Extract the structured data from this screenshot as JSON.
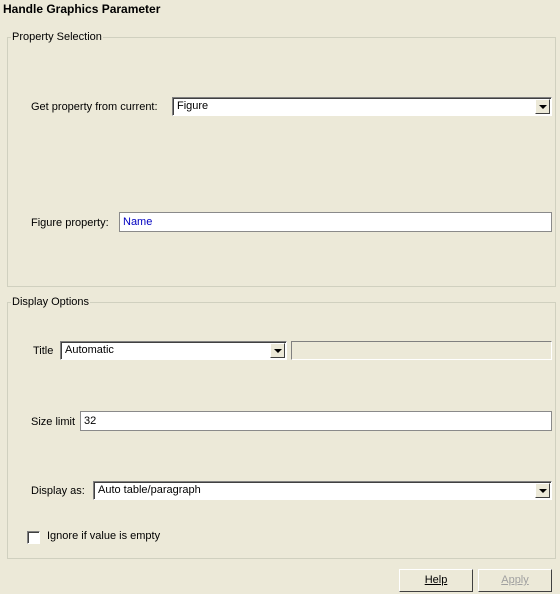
{
  "header": {
    "title": "Handle Graphics Parameter"
  },
  "property_selection": {
    "legend": "Property Selection",
    "get_property_label": "Get property from current:",
    "get_property_value": "Figure",
    "figure_property_label": "Figure property:",
    "figure_property_value": "Name"
  },
  "display_options": {
    "legend": "Display Options",
    "title_label": "Title",
    "title_value": "Automatic",
    "title_text_value": "",
    "size_limit_label": "Size limit",
    "size_limit_value": "32",
    "display_as_label": "Display as:",
    "display_as_value": "Auto table/paragraph",
    "ignore_empty_label": "Ignore if value is empty",
    "ignore_empty_checked": false
  },
  "footer": {
    "help_label": "Help",
    "apply_label": "Apply"
  },
  "colors": {
    "value_text_blue": "#0000c0"
  }
}
